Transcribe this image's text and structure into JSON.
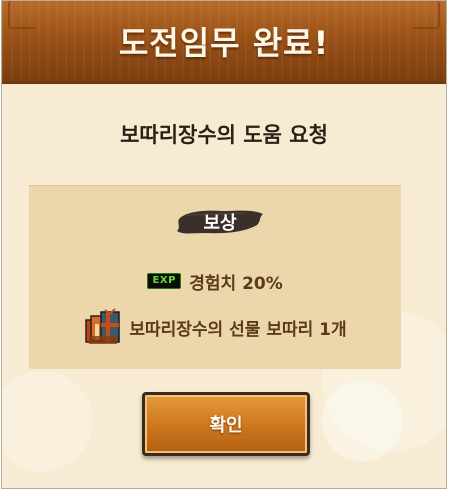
{
  "dialog": {
    "title": "도전임무 완료!",
    "quest_name": "보따리장수의 도움 요청"
  },
  "reward": {
    "heading": "보상",
    "items": [
      {
        "icon": "exp-badge-icon",
        "badge_text": "EXP",
        "label": "경험치 20%"
      },
      {
        "icon": "gift-bundle-icon",
        "label": "보따리장수의 선물 보따리 1개"
      }
    ]
  },
  "confirm_label": "확인",
  "colors": {
    "header": "#9a5217",
    "background": "#f7ecd3",
    "reward_panel": "#ecd7ad",
    "button": "#cf7a20",
    "text_dark": "#2b2017",
    "text_reward": "#5a3a1a"
  }
}
